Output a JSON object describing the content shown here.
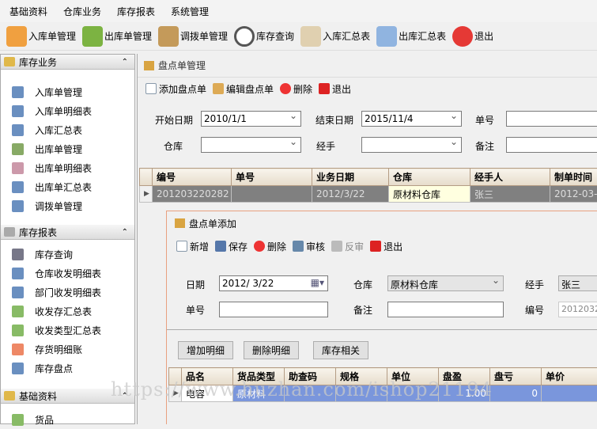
{
  "menu": [
    "基础资料",
    "仓库业务",
    "库存报表",
    "系统管理"
  ],
  "toolbar": [
    {
      "label": "入库单管理",
      "icon": "stock-in-icon",
      "color": "#f0a040"
    },
    {
      "label": "出库单管理",
      "icon": "stock-out-icon",
      "color": "#7cb342"
    },
    {
      "label": "调拨单管理",
      "icon": "transfer-icon",
      "color": "#c49a5a"
    },
    {
      "label": "库存查询",
      "icon": "search-icon",
      "color": "#cfd8dc"
    },
    {
      "label": "入库汇总表",
      "icon": "report-icon",
      "color": "#e0d0b0"
    },
    {
      "label": "出库汇总表",
      "icon": "table-icon",
      "color": "#90b4e0"
    },
    {
      "label": "退出",
      "icon": "close-icon",
      "color": "#e53935"
    }
  ],
  "sidebar": {
    "s1": {
      "title": "库存业务",
      "items": [
        "入库单管理",
        "入库单明细表",
        "入库汇总表",
        "出库单管理",
        "出库单明细表",
        "出库单汇总表",
        "调拨单管理"
      ]
    },
    "s2": {
      "title": "库存报表",
      "items": [
        "库存查询",
        "仓库收发明细表",
        "部门收发明细表",
        "收发存汇总表",
        "收发类型汇总表",
        "存货明细账",
        "库存盘点"
      ]
    },
    "s3": {
      "title": "基础资料",
      "items": [
        "货品"
      ]
    }
  },
  "panel": {
    "title": "盘点单管理",
    "actions": [
      "添加盘点单",
      "编辑盘点单",
      "删除",
      "退出"
    ],
    "filters": {
      "start_label": "开始日期",
      "start": "2010/1/1",
      "end_label": "结束日期",
      "end": "2015/11/4",
      "no_label": "单号",
      "wh_label": "仓库",
      "handler_label": "经手",
      "remark_label": "备注"
    },
    "columns": [
      "编号",
      "单号",
      "业务日期",
      "仓库",
      "经手人",
      "制单时间"
    ],
    "rows": [
      [
        "201203220282",
        "",
        "2012/3/22",
        "原材料仓库",
        "张三",
        "2012-03-"
      ]
    ]
  },
  "dialog": {
    "title": "盘点单添加",
    "actions": [
      "新增",
      "保存",
      "删除",
      "审核",
      "反审",
      "退出"
    ],
    "date_label": "日期",
    "date": "2012/ 3/22",
    "wh_label": "仓库",
    "wh": "原材料仓库",
    "handler_label": "经手",
    "handler": "张三",
    "no_label": "单号",
    "no": "",
    "remark_label": "备注",
    "remark": "",
    "code_label": "编号",
    "code": "2012032",
    "buttons": [
      "增加明细",
      "删除明细",
      "库存相关"
    ],
    "columns": [
      "品名",
      "货品类型",
      "助查码",
      "规格",
      "单位",
      "盘盈",
      "盘亏",
      "单价"
    ],
    "rows": [
      [
        "电容",
        "原材料",
        "",
        "",
        "",
        "1.00",
        "0",
        ""
      ]
    ]
  },
  "watermark": "https://www.huzhan.com/ishop21194"
}
